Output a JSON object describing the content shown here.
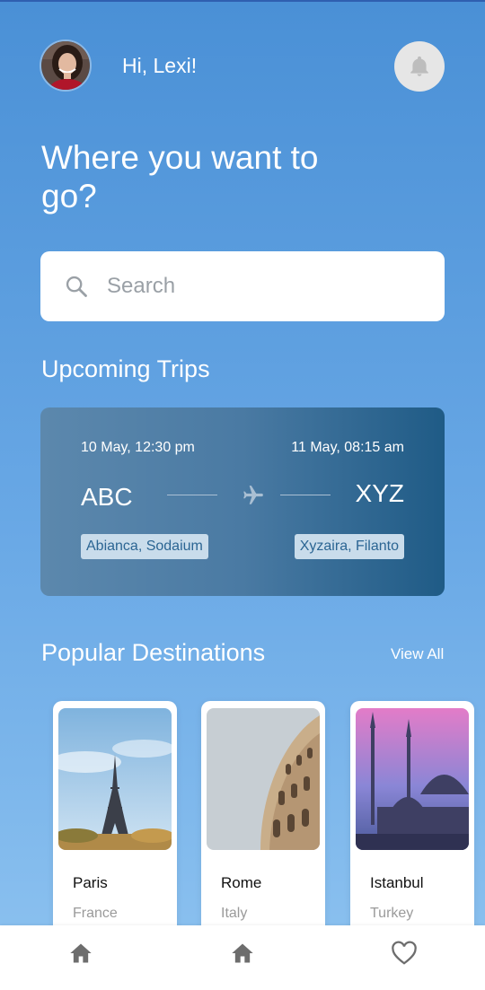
{
  "header": {
    "greeting": "Hi, Lexi!",
    "avatar_icon": "avatar",
    "notification_icon": "bell-icon"
  },
  "headline": "Where you want to go?",
  "search": {
    "placeholder": "Search",
    "value": "",
    "icon": "search-icon"
  },
  "upcoming": {
    "title": "Upcoming Trips",
    "trip": {
      "departure_time": "10 May, 12:30 pm",
      "arrival_time": "11 May, 08:15 am",
      "departure_code": "ABC",
      "arrival_code": "XYZ",
      "departure_place": "Abianca, Sodaium",
      "arrival_place": "Xyzaira, Filanto",
      "icon": "airplane-icon"
    }
  },
  "popular": {
    "title": "Popular Destinations",
    "view_all": "View All",
    "destinations": [
      {
        "city": "Paris",
        "country": "France"
      },
      {
        "city": "Rome",
        "country": "Italy"
      },
      {
        "city": "Istanbul",
        "country": "Turkey"
      }
    ]
  },
  "nav": {
    "items": [
      {
        "icon": "home-icon"
      },
      {
        "icon": "home-icon"
      },
      {
        "icon": "heart-icon"
      }
    ]
  },
  "colors": {
    "background_top": "#4a90d6",
    "background_bottom": "#8ec3f0",
    "card_dark": "#1f5b86",
    "chip_bg": "#c9dceb",
    "chip_text": "#2b6593"
  }
}
